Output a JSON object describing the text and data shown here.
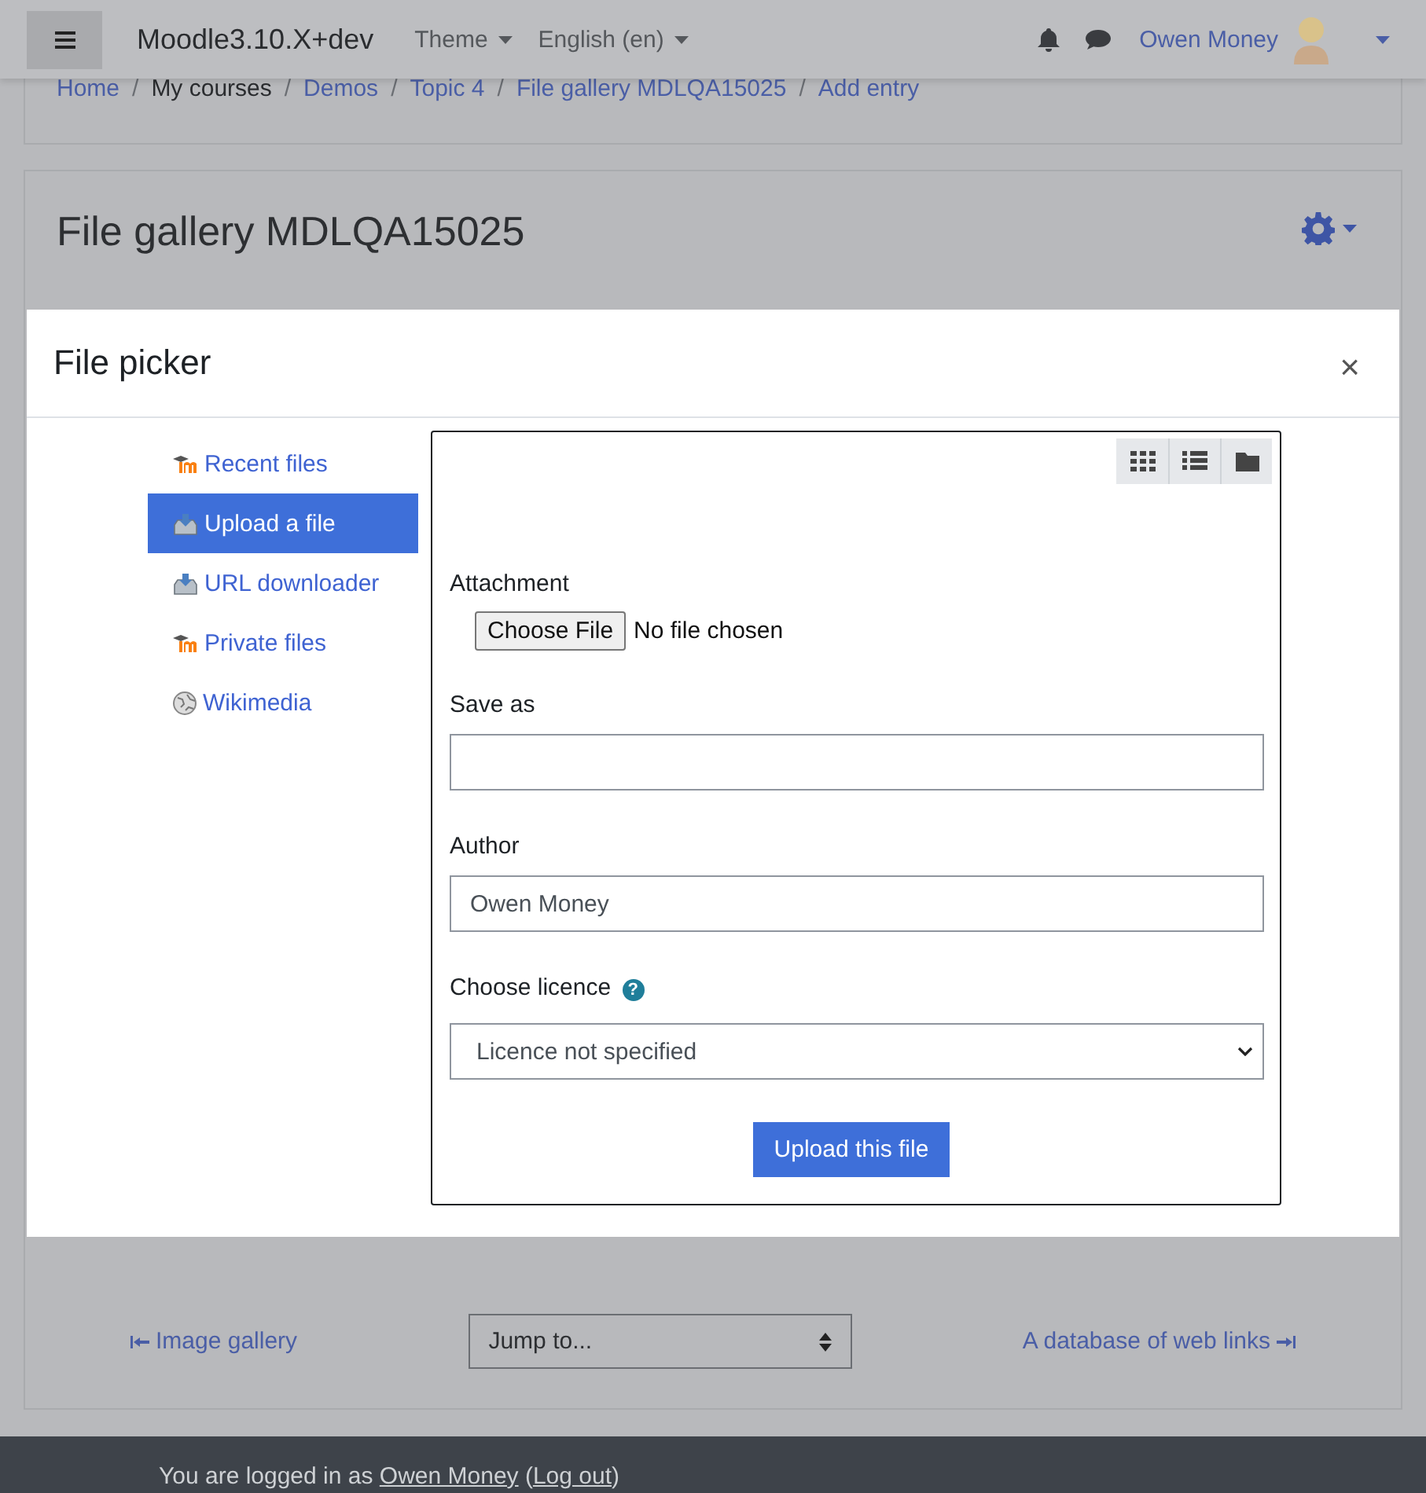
{
  "navbar": {
    "site_name": "Moodle3.10.X+dev",
    "menus": [
      {
        "label": "Theme"
      },
      {
        "label": "English (en)"
      }
    ],
    "user_name": "Owen Money"
  },
  "breadcrumb": {
    "items": [
      {
        "label": "Home",
        "link": true
      },
      {
        "label": "My courses",
        "link": false
      },
      {
        "label": "Demos",
        "link": true
      },
      {
        "label": "Topic 4",
        "link": true
      },
      {
        "label": "File gallery MDLQA15025",
        "link": true
      },
      {
        "label": "Add entry",
        "link": true
      }
    ],
    "separators": [
      "/",
      "/",
      "/",
      "/",
      "/"
    ]
  },
  "page": {
    "title": "File gallery MDLQA15025"
  },
  "activity_nav": {
    "previous": "Image gallery",
    "jump": "Jump to...",
    "next": "A database of web links"
  },
  "footer": {
    "intro": "You are logged in as",
    "user_link": "Owen Money",
    "open": "(",
    "logout_link": "Log out",
    "close": ")"
  },
  "file_picker": {
    "title": "File picker",
    "close": "×",
    "repositories": [
      {
        "label": "Recent files",
        "kind": "moodle",
        "selected": false
      },
      {
        "label": "Upload a file",
        "kind": "upload",
        "selected": true
      },
      {
        "label": "URL downloader",
        "kind": "upload",
        "selected": false
      },
      {
        "label": "Private files",
        "kind": "moodle",
        "selected": false
      },
      {
        "label": "Wikimedia",
        "kind": "globe",
        "selected": false
      }
    ],
    "view_buttons": [
      {
        "kind": "icons"
      },
      {
        "kind": "list"
      },
      {
        "kind": "tree"
      }
    ],
    "attachment_label": "Attachment",
    "choose_button": "Choose File",
    "no_file": "No file chosen",
    "save_as_label": "Save as",
    "author_label": "Author",
    "author_value": "Owen Money",
    "licence_label": "Choose licence",
    "help_glyph": "?",
    "licence_value": "Licence not specified",
    "upload_button": "Upload this file"
  }
}
